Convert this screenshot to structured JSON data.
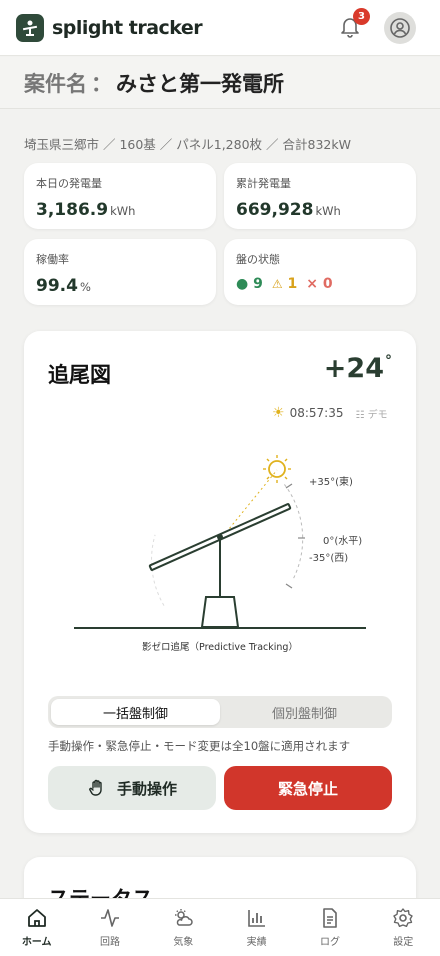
{
  "app": {
    "title": "splight tracker",
    "notification_count": "3"
  },
  "page": {
    "title_prefix": "案件名",
    "title_colon": "：",
    "title_name": "みさと第一発電所"
  },
  "site_info": "埼玉県三郷市 ／ 160基 ／ パネル1,280枚 ／ 合計832kW",
  "stats": {
    "today_label": "本日の発電量",
    "today_value": "3,186.9",
    "today_unit": "kWh",
    "total_label": "累計発電量",
    "total_value": "669,928",
    "total_unit": "kWh",
    "rate_label": "稼働率",
    "rate_value": "99.4",
    "rate_unit": "%",
    "panel_label": "盤の状態",
    "panel_ok": "9",
    "panel_warn": "1",
    "panel_err": "0"
  },
  "tracking": {
    "title": "追尾図",
    "angle": "+24",
    "angle_unit": "°",
    "time": "08:57:35",
    "demo_label": "デモ",
    "label_east": "+35°(東)",
    "label_level": "0°(水平)",
    "label_west": "-35°(西)",
    "caption": "影ゼロ追尾（Predictive Tracking）",
    "tilt_degrees": 24,
    "mode_tabs": [
      "一括盤制御",
      "個別盤制御"
    ],
    "note": "手動操作・緊急停止・モード変更は全10盤に適用されます",
    "manual_button": "手動操作",
    "stop_button": "緊急停止"
  },
  "status_card": {
    "title": "ステータス"
  },
  "tabs": [
    "ホーム",
    "回路",
    "気象",
    "実績",
    "ログ",
    "設定"
  ],
  "colors": {
    "brand": "#2f4a3a",
    "danger": "#d1362b",
    "ok": "#2e8b57",
    "warn": "#d9a21b",
    "sun": "#e0b21e"
  }
}
